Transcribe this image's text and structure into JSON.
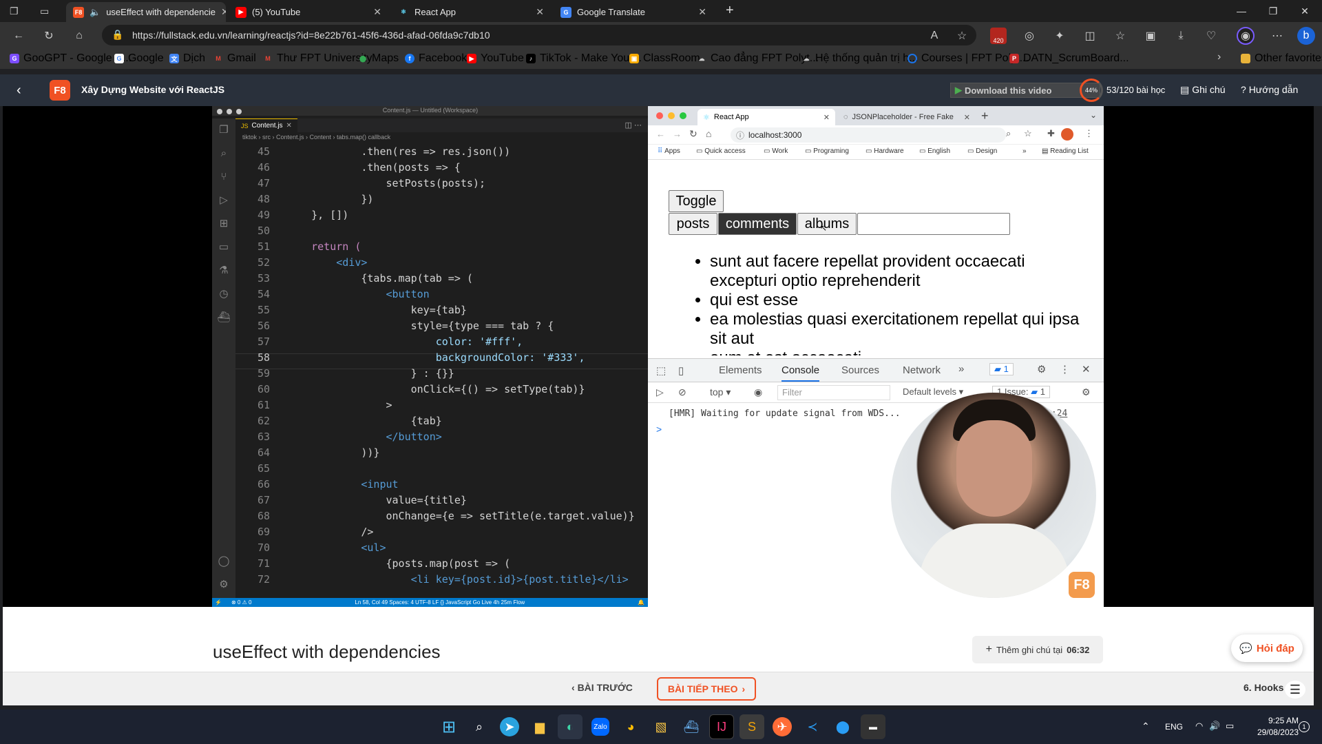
{
  "browser": {
    "tabs": [
      {
        "title": "useEffect with dependencie",
        "icon": "f8-logo-icon",
        "active": true
      },
      {
        "title": "(5) YouTube",
        "icon": "youtube-icon"
      },
      {
        "title": "React App",
        "icon": "react-icon"
      },
      {
        "title": "Google Translate",
        "icon": "google-translate-icon"
      }
    ],
    "url": "https://fullstack.edu.vn/learning/reactjs?id=8e22b761-45f6-436d-afad-06fda9c7db10",
    "extension_badge": "420",
    "bookmarks": [
      "GooGPT - Google S...",
      "Google",
      "Dịch",
      "Gmail",
      "Thư FPT University",
      "Maps",
      "Facebook",
      "YouTube",
      "TikTok - Make Your...",
      "ClassRoom",
      "Cao đẳng FPT Polyt...",
      "Hệ thống quản trị h...",
      "Courses | FPT Polyt...",
      "DATN_ScrumBoard..."
    ],
    "other_favorites": "Other favorites"
  },
  "course": {
    "logo": "F8",
    "title": "Xây Dựng Website với ReactJS",
    "progress_percent": "44%",
    "lessons": "53/120 bài học",
    "notes": "Ghi chú",
    "guide": "Hướng dẫn",
    "download": "Download this video"
  },
  "vscode": {
    "window_title": "Content.js — Untitled (Workspace)",
    "tab": "Content.js",
    "breadcrumb": "tiktok › src › Content.js › Content › tabs.map() callback",
    "lines": [
      {
        "n": "45",
        "t": "            .then(res => res.json())"
      },
      {
        "n": "46",
        "t": "            .then(posts => {"
      },
      {
        "n": "47",
        "t": "                setPosts(posts);"
      },
      {
        "n": "48",
        "t": "            })"
      },
      {
        "n": "49",
        "t": "    }, [])"
      },
      {
        "n": "50",
        "t": ""
      },
      {
        "n": "51",
        "t": "    return ("
      },
      {
        "n": "52",
        "t": "        <div>"
      },
      {
        "n": "53",
        "t": "            {tabs.map(tab => ("
      },
      {
        "n": "54",
        "t": "                <button"
      },
      {
        "n": "55",
        "t": "                    key={tab}"
      },
      {
        "n": "56",
        "t": "                    style={type === tab ? {"
      },
      {
        "n": "57",
        "t": "                        color: '#fff',"
      },
      {
        "n": "58",
        "t": "                        backgroundColor: '#333',"
      },
      {
        "n": "59",
        "t": "                    } : {}}"
      },
      {
        "n": "60",
        "t": "                    onClick={() => setType(tab)}"
      },
      {
        "n": "61",
        "t": "                >"
      },
      {
        "n": "62",
        "t": "                    {tab}"
      },
      {
        "n": "63",
        "t": "                </button>"
      },
      {
        "n": "64",
        "t": "            ))}"
      },
      {
        "n": "65",
        "t": ""
      },
      {
        "n": "66",
        "t": "            <input"
      },
      {
        "n": "67",
        "t": "                value={title}"
      },
      {
        "n": "68",
        "t": "                onChange={e => setTitle(e.target.value)}"
      },
      {
        "n": "69",
        "t": "            />"
      },
      {
        "n": "70",
        "t": "            <ul>"
      },
      {
        "n": "71",
        "t": "                {posts.map(post => ("
      },
      {
        "n": "72",
        "t": "                    <li key={post.id}>{post.title}</li>"
      }
    ],
    "statusbar": "Ln 58, Col 49   Spaces: 4   UTF-8   LF   {} JavaScript   Go Live   4h 25m   Flow",
    "errors": "0 ⚠ 0"
  },
  "react_app": {
    "tabs": [
      "React App",
      "JSONPlaceholder - Free Fake"
    ],
    "url": "localhost:3000",
    "bookmarks": [
      "Apps",
      "Quick access",
      "Work",
      "Programing",
      "Hardware",
      "English",
      "Design"
    ],
    "reading_list": "Reading List",
    "toggle": "Toggle",
    "type_buttons": [
      "posts",
      "comments",
      "albums"
    ],
    "active_type": "comments",
    "items": [
      "sunt aut facere repellat provident occaecati excepturi optio reprehenderit",
      "qui est esse",
      "ea molestias quasi exercitationem repellat qui ipsa sit aut",
      "eum et est occaecati"
    ]
  },
  "devtools": {
    "tabs": [
      "Elements",
      "Console",
      "Sources",
      "Network"
    ],
    "active": "Console",
    "message_count": "1",
    "context": "top",
    "filter_placeholder": "Filter",
    "levels": "Default levels",
    "issues": "1 Issue:",
    "issues_count": "1",
    "log": "[HMR] Waiting for update signal from WDS...",
    "log_source": "s:24",
    "prompt": ">"
  },
  "lesson": {
    "title": "useEffect with dependencies",
    "add_note": "Thêm ghi chú tại",
    "add_note_time": "06:32",
    "help": "Hỏi đáp",
    "prev": "BÀI TRƯỚC",
    "next": "BÀI TIẾP THEO",
    "section": "6. Hooks"
  },
  "taskbar": {
    "lang": "ENG",
    "time": "9:25 AM",
    "date": "29/08/2023",
    "notifications": "1"
  },
  "colors": {
    "f8_orange": "#f05123",
    "header_bg": "#29303b",
    "active_type_bg": "#333333"
  }
}
